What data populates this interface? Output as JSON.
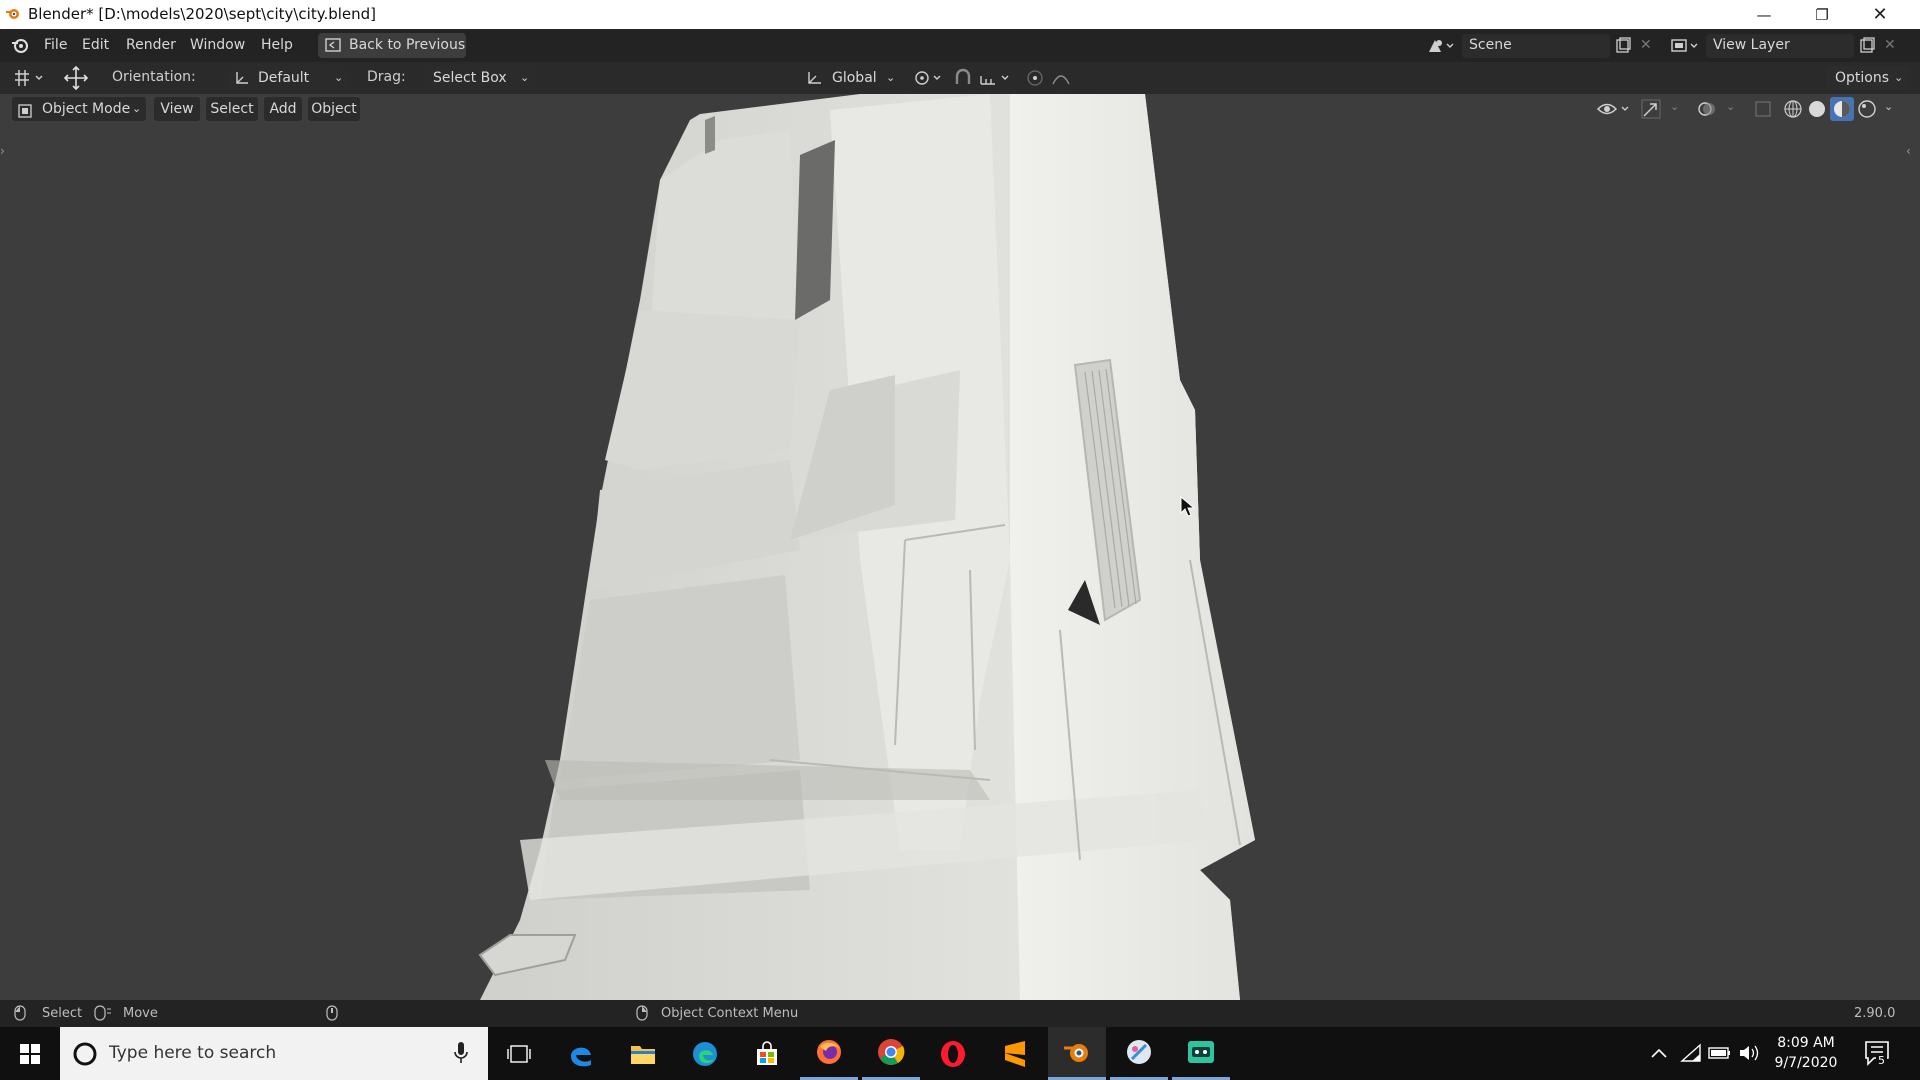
{
  "window": {
    "title": "Blender* [D:\\models\\2020\\sept\\city\\city.blend]"
  },
  "menu": {
    "items": [
      "File",
      "Edit",
      "Render",
      "Window",
      "Help"
    ],
    "back_button": "Back to Previous",
    "scene_label": "Scene",
    "view_layer_label": "View Layer"
  },
  "tool_header": {
    "orientation_label": "Orientation:",
    "orientation_value": "Default",
    "drag_label": "Drag:",
    "drag_value": "Select Box",
    "transform_orientation": "Global",
    "options_label": "Options"
  },
  "viewport_header": {
    "mode": "Object Mode",
    "menus": [
      "View",
      "Select",
      "Add",
      "Object"
    ]
  },
  "status_bar": {
    "select": "Select",
    "move": "Move",
    "context_menu": "Object Context Menu",
    "version": "2.90.0"
  },
  "taskbar": {
    "search_placeholder": "Type here to search",
    "time": "8:09 AM",
    "date": "9/7/2020",
    "notification_count": "5",
    "apps": [
      "task-view",
      "edge-legacy",
      "file-explorer",
      "edge",
      "store",
      "firefox",
      "chrome",
      "opera",
      "sublime-text",
      "blender",
      "krita",
      "app"
    ]
  },
  "colors": {
    "accent": "#4772b3",
    "viewport_bg": "#3d3d3d",
    "model": "#e6e6e2"
  }
}
